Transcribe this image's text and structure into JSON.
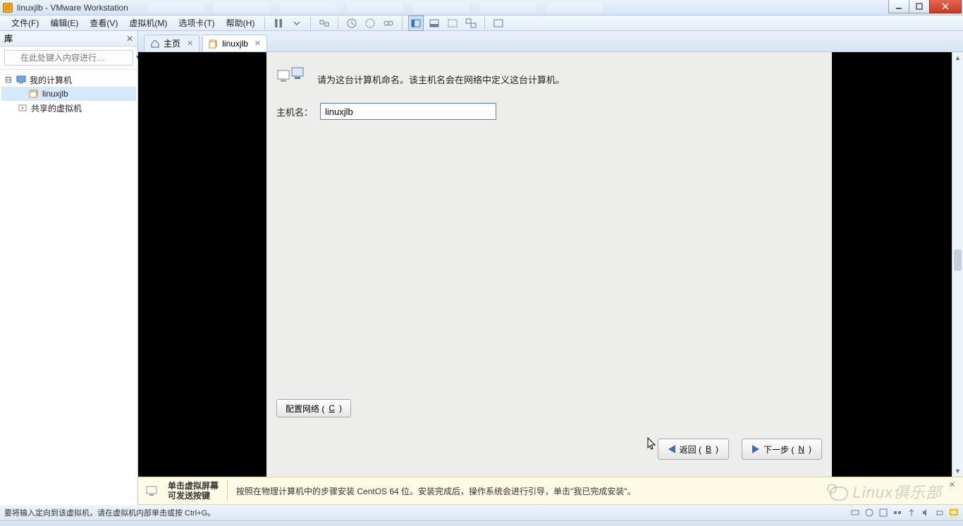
{
  "titlebar": {
    "title": "linuxjlb - VMware Workstation"
  },
  "menubar": {
    "items": [
      "文件(F)",
      "编辑(E)",
      "查看(V)",
      "虚拟机(M)",
      "选项卡(T)",
      "帮助(H)"
    ]
  },
  "sidebar": {
    "header": "库",
    "search_placeholder": "在此处键入内容进行…",
    "nodes": {
      "root": "我的计算机",
      "vm": "linuxjlb",
      "shared": "共享的虚拟机"
    }
  },
  "tabs": {
    "home": "主页",
    "vm": "linuxjlb"
  },
  "installer": {
    "description": "请为这台计算机命名。该主机名会在网络中定义这台计算机。",
    "hostname_label": "主机名：",
    "hostname_value": "linuxjlb",
    "configure_network": "配置网络 (",
    "configure_network_key": "C",
    "configure_network_end": ")",
    "back": "返回 (",
    "back_key": "B",
    "back_end": ")",
    "next": "下一步 (",
    "next_key": "N",
    "next_end": ")"
  },
  "tipbar": {
    "title": "单击虚拟屏幕\n可发送按键",
    "body": "按照在物理计算机中的步骤安装 CentOS 64 位。安装完成后，操作系统会进行引导，单击\"我已完成安装\"。"
  },
  "statusbar": {
    "text": "要将输入定向到该虚拟机，请在虚拟机内部单击或按 Ctrl+G。"
  },
  "watermark": "Linux俱乐部"
}
